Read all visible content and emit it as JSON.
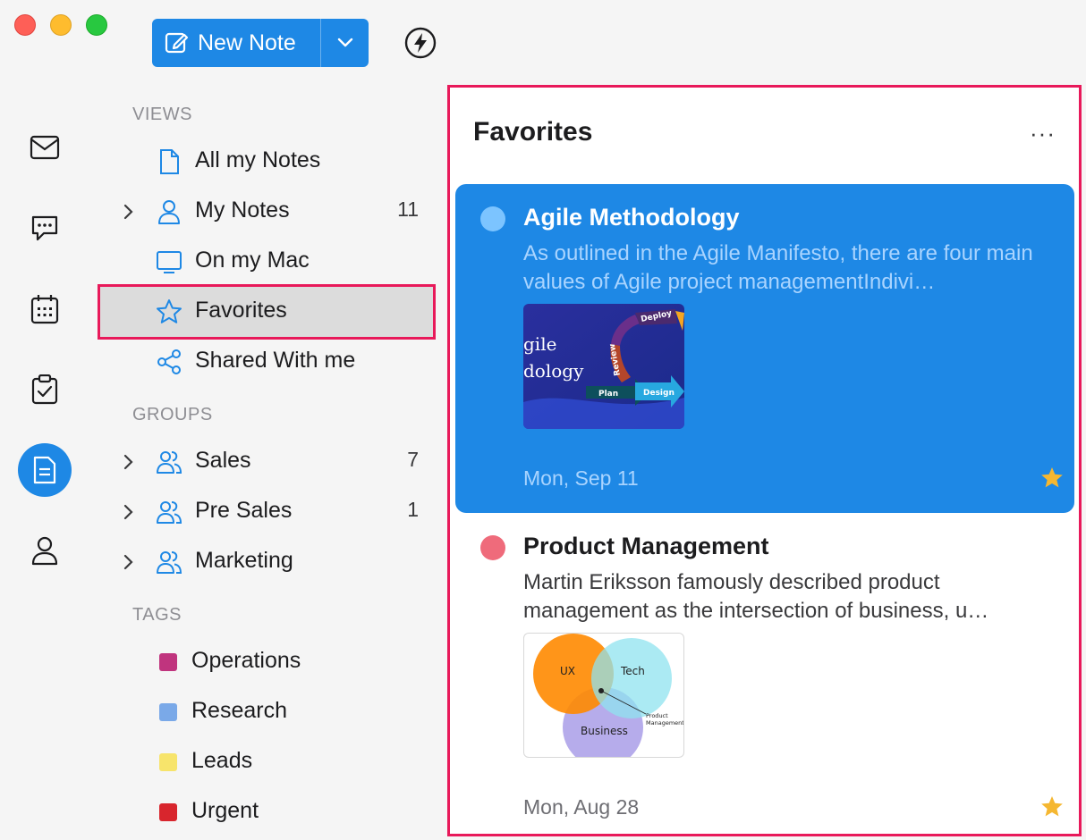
{
  "toolbar": {
    "new_note_label": "New Note"
  },
  "sidebar": {
    "sections": {
      "views": "VIEWS",
      "groups": "GROUPS",
      "tags": "TAGS"
    },
    "views": [
      {
        "label": "All my Notes",
        "count": "",
        "icon": "document-icon"
      },
      {
        "label": "My Notes",
        "count": "11",
        "icon": "person-icon"
      },
      {
        "label": "On my Mac",
        "count": "",
        "icon": "monitor-icon"
      },
      {
        "label": "Favorites",
        "count": "",
        "icon": "star-outline-icon"
      },
      {
        "label": "Shared With me",
        "count": "",
        "icon": "share-icon"
      }
    ],
    "groups": [
      {
        "label": "Sales",
        "count": "7"
      },
      {
        "label": "Pre Sales",
        "count": "1"
      },
      {
        "label": "Marketing",
        "count": ""
      }
    ],
    "tags": [
      {
        "label": "Operations",
        "color": "#c0347e"
      },
      {
        "label": "Research",
        "color": "#7aa9e8"
      },
      {
        "label": "Leads",
        "color": "#f7e46b"
      },
      {
        "label": "Urgent",
        "color": "#d8252d"
      }
    ]
  },
  "panel": {
    "title": "Favorites",
    "more_label": "···",
    "notes": [
      {
        "title": "Agile Methodology",
        "excerpt": "As outlined in the Agile Manifesto, there are four main values of Agile project managementIndivi…",
        "date": "Mon, Sep 11",
        "dot_color": "#7cc4ff",
        "thumb_text": {
          "l1": "gile",
          "l2": "dology",
          "deploy": "Deploy",
          "review": "Review",
          "plan": "Plan",
          "design": "Design"
        }
      },
      {
        "title": "Product Management",
        "excerpt": "Martin Eriksson famously described product management as the intersection of business, u…",
        "date": "Mon, Aug 28",
        "dot_color": "#ef6b7b",
        "thumb_text": {
          "ux": "UX",
          "tech": "Tech",
          "business": "Business",
          "pm1": "Product",
          "pm2": "Management"
        }
      }
    ]
  },
  "colors": {
    "accent": "#1e88e5",
    "highlight_border": "#e8195a",
    "star": "#f5b731"
  }
}
